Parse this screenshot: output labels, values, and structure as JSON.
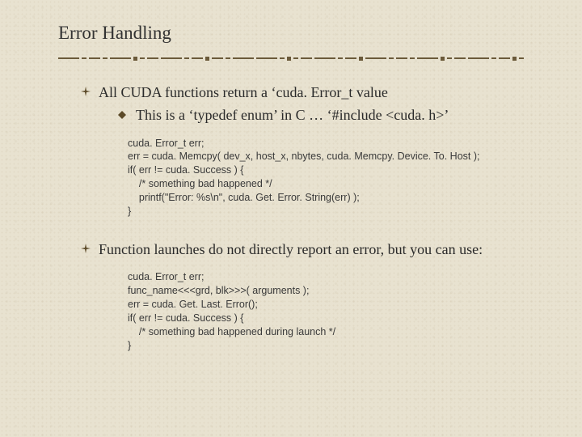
{
  "title": "Error Handling",
  "bullet1": {
    "text": "All CUDA functions return a ‘cuda. Error_t value",
    "sub": "This is a ‘typedef enum’ in C … ‘#include <cuda. h>’"
  },
  "code1": "cuda. Error_t err;\nerr = cuda. Memcpy( dev_x, host_x, nbytes, cuda. Memcpy. Device. To. Host );\nif( err != cuda. Success ) {\n    /* something bad happened */\n    printf(\"Error: %s\\n\", cuda. Get. Error. String(err) );\n}",
  "bullet2": {
    "text": "Function launches do not directly report an error, but you can use:"
  },
  "code2": "cuda. Error_t err;\nfunc_name<<<grd, blk>>>( arguments );\nerr = cuda. Get. Last. Error();\nif( err != cuda. Success ) {\n    /* something bad happened during launch */\n}"
}
